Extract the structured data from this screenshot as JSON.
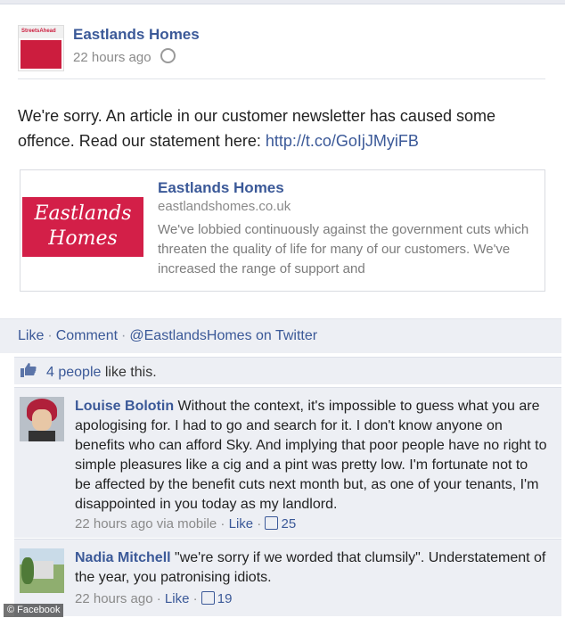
{
  "post": {
    "author": "Eastlands Homes",
    "timestamp": "22 hours ago",
    "message_text": "We're sorry. An article in our customer newsletter has caused some offence. Read our statement here: ",
    "message_link": "http://t.co/GoIjJMyiFB",
    "thumbnail_text": "StreetsAhead"
  },
  "share": {
    "logo_line1": "Eastlands",
    "logo_line2": "Homes",
    "title": "Eastlands Homes",
    "domain": "eastlandshomes.co.uk",
    "description": "We've lobbied continuously against the government cuts which threaten the quality of life for many of our customers.  We've increased the range of support and"
  },
  "actions": {
    "like": "Like",
    "comment": "Comment",
    "via": "@EastlandsHomes on Twitter",
    "separator": "·"
  },
  "likes": {
    "count_text": "4 people",
    "suffix": " like this."
  },
  "comments": [
    {
      "name": "Louise Bolotin",
      "text": " Without the context, it's impossible to guess what you are apologising for. I had to go and search for it. I don't know anyone on benefits who can afford Sky. And implying that poor people have no right to simple pleasures like a cig and a pint was pretty low. I'm fortunate not to be affected by the benefit cuts next month but, as one of your tenants, I'm disappointed in you today as my landlord.",
      "meta_time": "22 hours ago via mobile",
      "like_label": "Like",
      "likes": "25"
    },
    {
      "name": "Nadia Mitchell",
      "text": " \"we're sorry if we worded that clumsily\". Understatement of the year, you patronising idiots.",
      "meta_time": "22 hours ago",
      "like_label": "Like",
      "likes": "19"
    }
  ],
  "watermark": "© Facebook",
  "colors": {
    "link_blue": "#3b5998",
    "brand_red": "#d31f48",
    "panel_bg": "#edeff4"
  }
}
